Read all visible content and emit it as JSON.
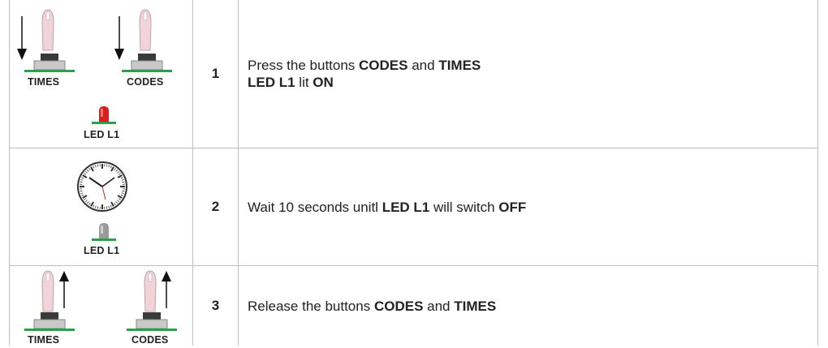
{
  "steps": [
    {
      "number": "1",
      "labels": {
        "left_button": "TIMES",
        "right_button": "CODES",
        "led": "LED L1"
      },
      "led_state": "on",
      "led_color": "#d7201e",
      "line1": {
        "t1": "Press the buttons ",
        "b1": "CODES",
        "t2": " and ",
        "b2": "TIMES"
      },
      "line2": {
        "b1": "LED L1",
        "t1": " lit ",
        "b2": "ON"
      }
    },
    {
      "number": "2",
      "labels": {
        "led": "LED L1"
      },
      "led_state": "off",
      "led_color": "#9a9a9a",
      "line1": {
        "t1": "Wait 10 seconds unitl ",
        "b1": "LED L1",
        "t2": " will switch ",
        "b2": "OFF"
      }
    },
    {
      "number": "3",
      "labels": {
        "left_button": "TIMES",
        "right_button": "CODES"
      },
      "line1": {
        "t1": "Release the buttons ",
        "b1": "CODES",
        "t2": " and ",
        "b2": "TIMES"
      }
    }
  ],
  "colors": {
    "board": "#2e9e4a",
    "border": "#bdbdbd",
    "finger": "#f2d4d8"
  }
}
